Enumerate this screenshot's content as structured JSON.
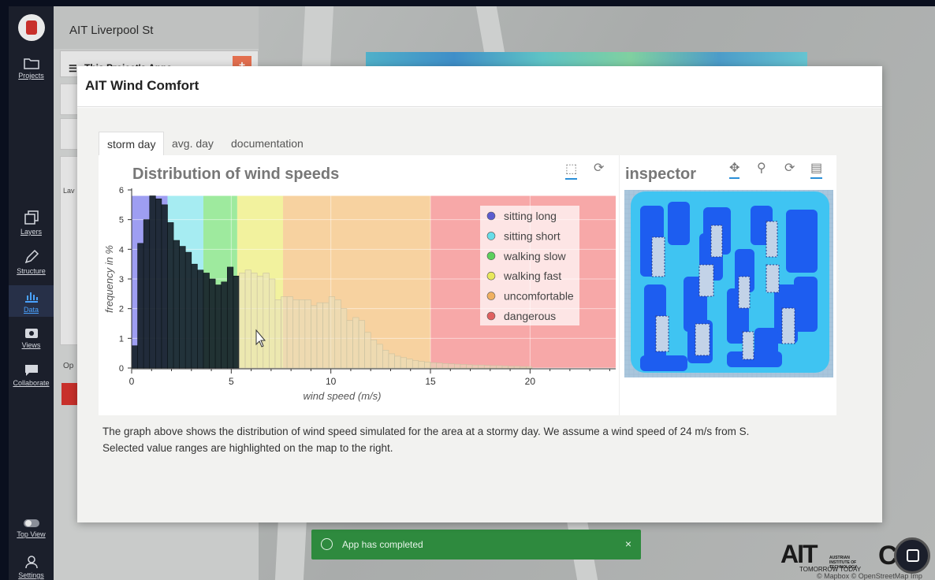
{
  "app": {
    "project_title": "AIT Liverpool St",
    "apps_panel_title": "This Project's Apps",
    "add_label": "+"
  },
  "nav": {
    "items": [
      {
        "label": "Projects",
        "icon": "folder-icon"
      },
      {
        "label": "Layers",
        "icon": "layers-icon"
      },
      {
        "label": "Structure",
        "icon": "pencil-icon"
      },
      {
        "label": "Data",
        "icon": "chart-icon"
      },
      {
        "label": "Views",
        "icon": "camera-icon"
      },
      {
        "label": "Collaborate",
        "icon": "chat-icon"
      },
      {
        "label": "Top View",
        "icon": "toggle-icon"
      },
      {
        "label": "Settings",
        "icon": "user-icon"
      }
    ]
  },
  "background": {
    "partial_labels": [
      "Lav",
      "Op"
    ],
    "colorbar_colors": [
      "#c44c4c",
      "#e8a05c",
      "#e8e05c",
      "#5cc45c",
      "#5cc4e0",
      "#5c5cc4"
    ]
  },
  "modal": {
    "title": "AIT Wind Comfort",
    "tabs": [
      "storm day",
      "avg. day",
      "documentation"
    ],
    "active_tab": 0,
    "chart_title": "Distribution of wind speeds",
    "inspector_title": "inspector",
    "description_line1": "The graph above shows the distribution of wind speed simulated for the area at a stormy day. We assume a wind speed of 24 m/s from S.",
    "description_line2": "Selected value ranges are highlighted on the map to the right."
  },
  "toast": {
    "message": "App has completed",
    "close": "×"
  },
  "branding": {
    "logo_text": "AIT",
    "logo_small": "AUSTRIAN INSTITUTE OF TECHNOLOGY",
    "tagline": "TOMORROW TODAY",
    "credit": "© Mapbox © OpenStreetMap Imp"
  },
  "chart_data": {
    "type": "bar",
    "title": "Distribution of wind speeds",
    "xlabel": "wind speed (m/s)",
    "ylabel": "frequency in %",
    "xlim": [
      0,
      24.3
    ],
    "ylim": [
      0,
      6
    ],
    "xticks": [
      0,
      5,
      10,
      15,
      20
    ],
    "yticks": [
      0,
      1,
      2,
      3,
      4,
      5,
      6
    ],
    "bin_width": 0.3,
    "selected_max": 5.4,
    "values": [
      0.75,
      4.2,
      5.0,
      5.8,
      5.7,
      5.5,
      4.9,
      4.3,
      4.1,
      3.9,
      3.5,
      3.3,
      3.2,
      3.0,
      2.8,
      2.9,
      3.4,
      3.1,
      3.2,
      3.3,
      3.2,
      3.1,
      3.2,
      3.0,
      2.3,
      2.4,
      2.4,
      2.3,
      2.3,
      2.3,
      2.1,
      2.2,
      2.2,
      2.4,
      2.3,
      2.0,
      1.6,
      1.7,
      1.6,
      1.2,
      0.95,
      0.8,
      0.6,
      0.48,
      0.4,
      0.35,
      0.3,
      0.25,
      0.22,
      0.2,
      0.18,
      0.17,
      0.15,
      0.14,
      0.13,
      0.12,
      0.11,
      0.1,
      0.1,
      0.09,
      0.08,
      0.08,
      0.07,
      0.06,
      0.06,
      0.05,
      0.05
    ],
    "ranges": [
      {
        "name": "sitting long",
        "from": 0,
        "to": 1.8,
        "color": "#9e9ef2"
      },
      {
        "name": "sitting short",
        "from": 1.8,
        "to": 3.6,
        "color": "#a6ecf2"
      },
      {
        "name": "walking slow",
        "from": 3.6,
        "to": 5.3,
        "color": "#9eea9e"
      },
      {
        "name": "walking fast",
        "from": 5.3,
        "to": 7.6,
        "color": "#f2f29e"
      },
      {
        "name": "uncomfortable",
        "from": 7.6,
        "to": 15,
        "color": "#f7d2a0"
      },
      {
        "name": "dangerous",
        "from": 15,
        "to": 24.3,
        "color": "#f7a8a8"
      }
    ],
    "legend_dot_colors": [
      "#5c5cd0",
      "#66dde8",
      "#5cd05c",
      "#e8e85c",
      "#f0b060",
      "#e06060"
    ],
    "legend_position": "top-right"
  }
}
